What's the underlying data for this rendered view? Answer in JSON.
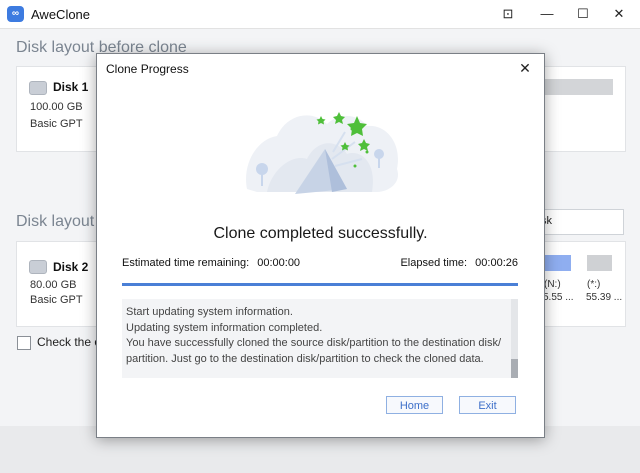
{
  "app": {
    "title": "AweClone"
  },
  "window_controls": {
    "restore": "⊡",
    "minimize": "—",
    "maximize": "☐",
    "close": "✕"
  },
  "main": {
    "section_before": "Disk layout before clone",
    "section_after": "Disk layout a",
    "disk1": {
      "name": "Disk 1",
      "size": "100.00 GB",
      "type": "Basic GPT"
    },
    "disk2": {
      "name": "Disk 2",
      "size": "80.00 GB",
      "type": "Basic GPT"
    },
    "search_text": "sk",
    "partitions": [
      {
        "label": "(N:)",
        "size": "5.55 ..."
      },
      {
        "label": "(*:)",
        "size": "55.39 ..."
      }
    ],
    "checkbox_label": "Check the op"
  },
  "dialog": {
    "title": "Clone Progress",
    "close_glyph": "✕",
    "status": "Clone completed successfully.",
    "estimated_label": "Estimated time remaining:",
    "estimated_value": "00:00:00",
    "elapsed_label": "Elapsed time:",
    "elapsed_value": "00:00:26",
    "progress": 1.0,
    "log_lines": [
      "Start updating system information.",
      "Updating system information completed.",
      "You have successfully cloned the source disk/partition to the destination disk/",
      "partition. Just go to the destination disk/partition to check the cloned data."
    ],
    "home_label": "Home",
    "exit_label": "Exit"
  },
  "colors": {
    "accent": "#4a7fd6",
    "partition_blue": "#8faef0",
    "partition_gray": "#cfd1d4"
  }
}
